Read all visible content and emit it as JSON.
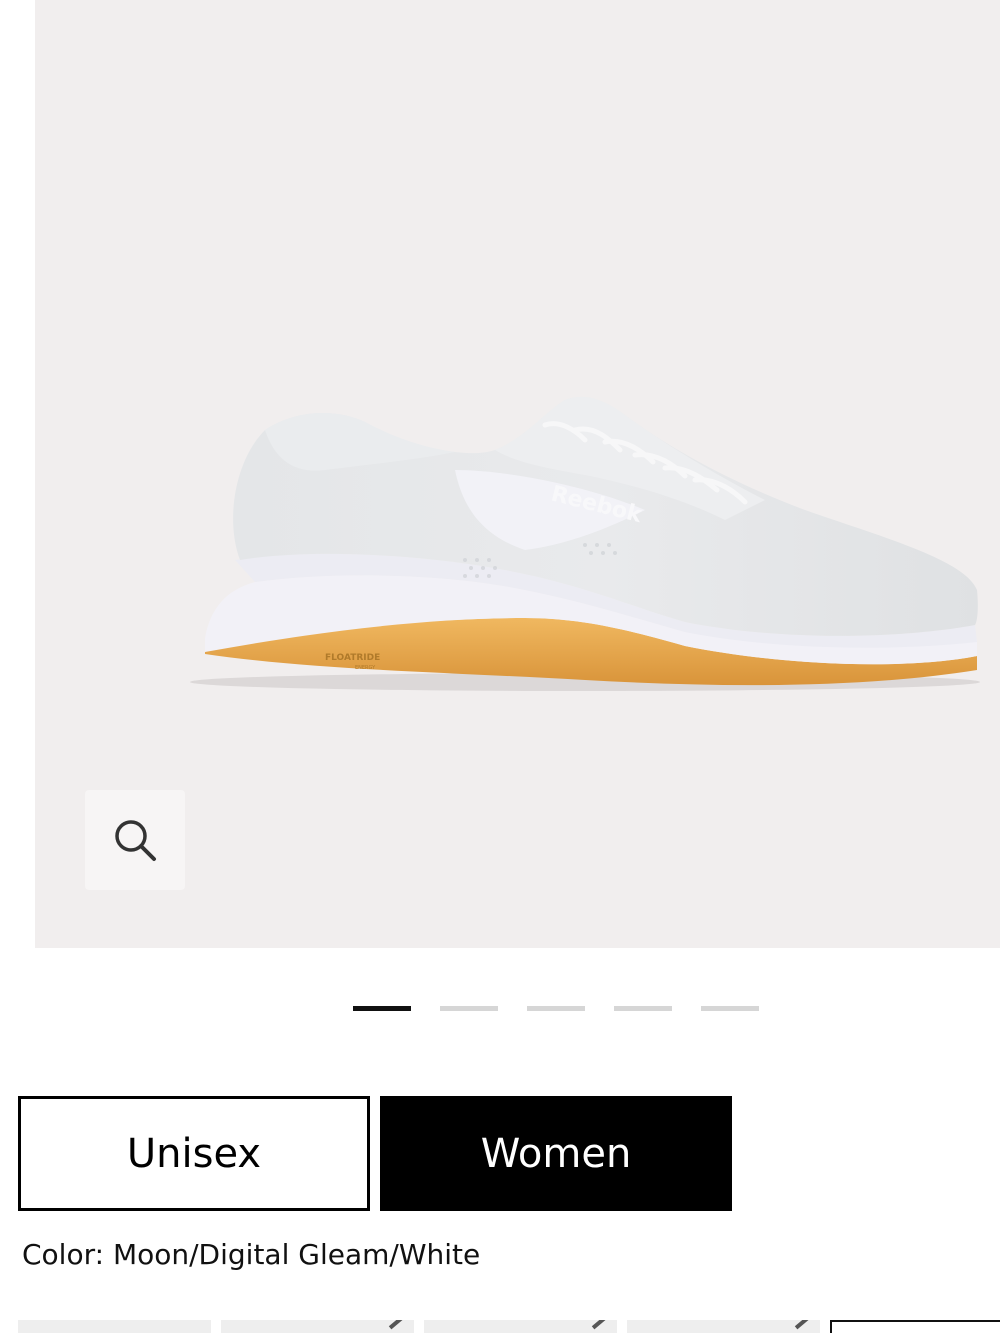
{
  "product": {
    "brand_logo_text": "Reebok",
    "midsole_text": "FLOATRIDE",
    "midsole_subtext": "ENERGY",
    "image_count": 5,
    "active_image_index": 0
  },
  "zoom_button": {
    "icon": "search-icon"
  },
  "gender_tabs": [
    {
      "label": "Unisex",
      "selected": false
    },
    {
      "label": "Women",
      "selected": true
    }
  ],
  "color": {
    "text": "Color: Moon/Digital Gleam/White"
  },
  "colors": {
    "gallery_background": "#f1eeee",
    "active_indicator": "#111111",
    "inactive_indicator": "#d6d6d6",
    "selected_tab_bg": "#000000",
    "sole_gum": "#e8a94f"
  }
}
